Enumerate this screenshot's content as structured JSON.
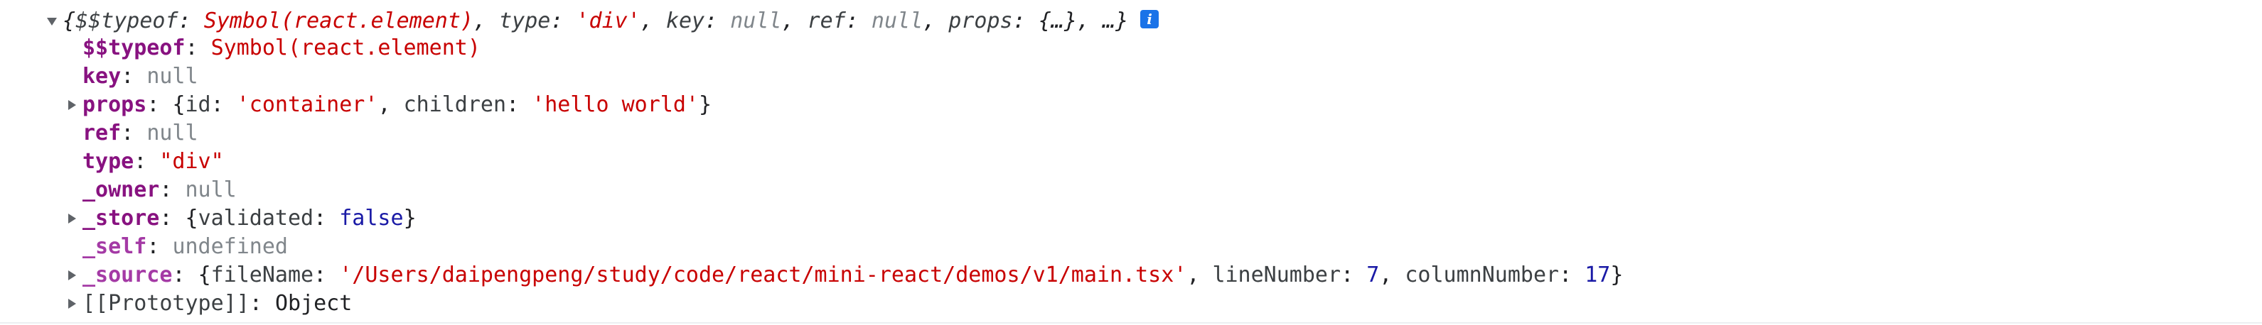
{
  "summary": {
    "open_brace": "{",
    "typeof_key": "$$typeof",
    "colon_sp": ": ",
    "typeof_val": "Symbol(react.element)",
    "comma_sp": ", ",
    "type_key": "type",
    "type_val": "'div'",
    "key_key": "key",
    "key_val": "null",
    "ref_key": "ref",
    "ref_val": "null",
    "props_key": "props",
    "props_val": "{…}",
    "ellipsis_close": "…}",
    "info_icon": "i"
  },
  "rows": {
    "typeof": {
      "key": "$$typeof",
      "value": "Symbol(react.element)"
    },
    "key": {
      "key": "key",
      "value": "null"
    },
    "props": {
      "key": "props",
      "open": "{",
      "id_key": "id",
      "id_val": "'container'",
      "children_key": "children",
      "children_val": "'hello world'",
      "close": "}"
    },
    "ref": {
      "key": "ref",
      "value": "null"
    },
    "type": {
      "key": "type",
      "value": "\"div\""
    },
    "owner": {
      "key": "_owner",
      "value": "null"
    },
    "store": {
      "key": "_store",
      "open": "{",
      "validated_key": "validated",
      "validated_val": "false",
      "close": "}"
    },
    "self": {
      "key": "_self",
      "value": "undefined"
    },
    "source": {
      "key": "_source",
      "open": "{",
      "filename_key": "fileName",
      "filename_val": "'/Users/daipengpeng/study/code/react/mini-react/demos/v1/main.tsx'",
      "linenumber_key": "lineNumber",
      "linenumber_val": "7",
      "columnnumber_key": "columnNumber",
      "columnnumber_val": "17",
      "close": "}"
    },
    "prototype": {
      "key": "[[Prototype]]",
      "value": "Object"
    }
  },
  "punct": {
    "colon_sp": ": ",
    "comma_sp": ", "
  },
  "colors": {
    "key": "#881280",
    "string": "#c80000",
    "null": "#80868b",
    "number": "#1a1aa6",
    "info_badge": "#1a73e8"
  }
}
